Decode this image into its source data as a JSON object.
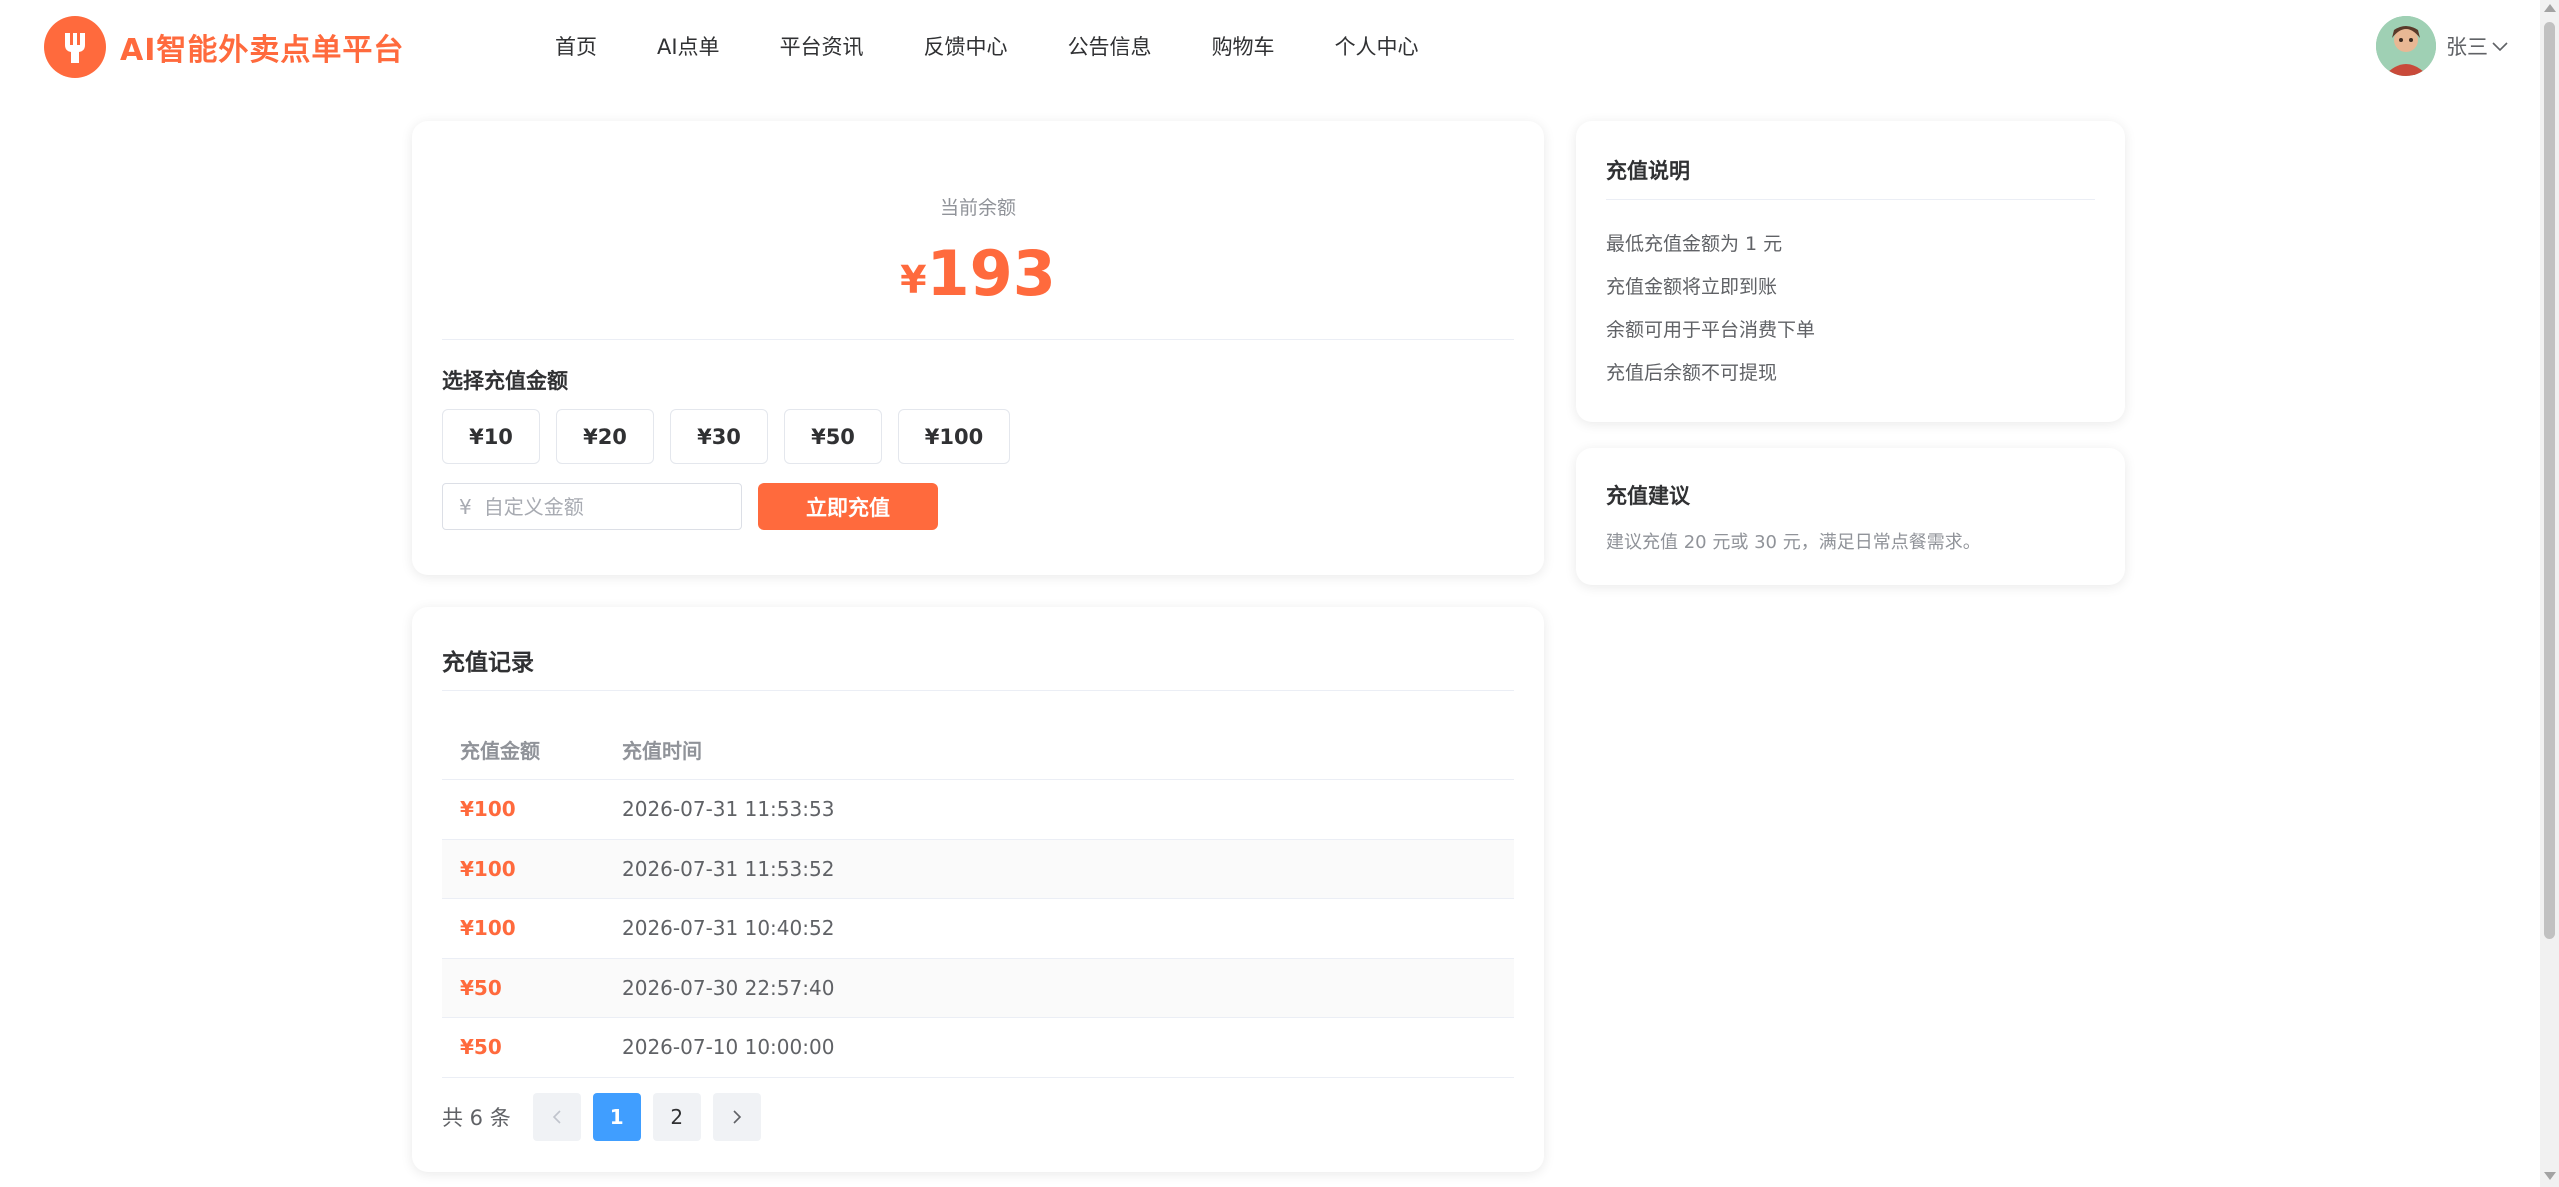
{
  "brand": {
    "name": "AI智能外卖点单平台",
    "color": "#ff6a3d",
    "logo_icon": "fork-knife-icon"
  },
  "nav": {
    "items": [
      {
        "label": "首页"
      },
      {
        "label": "AI点单"
      },
      {
        "label": "平台资讯"
      },
      {
        "label": "反馈中心"
      },
      {
        "label": "公告信息"
      },
      {
        "label": "购物车"
      },
      {
        "label": "个人中心"
      }
    ]
  },
  "user": {
    "name": "张三",
    "avatar_icon": "user-avatar",
    "dropdown_icon": "chevron-down-icon"
  },
  "balance": {
    "label": "当前余额",
    "currency": "¥",
    "amount": "193"
  },
  "recharge": {
    "title": "选择充值金额",
    "amounts": [
      "¥10",
      "¥20",
      "¥30",
      "¥50",
      "¥100"
    ],
    "custom_prefix": "¥",
    "custom_placeholder": "自定义金额",
    "custom_value": "",
    "submit_label": "立即充值"
  },
  "records": {
    "title": "充值记录",
    "columns": [
      "充值金额",
      "充值时间"
    ],
    "rows": [
      {
        "amount": "¥100",
        "time": "2026-07-31 11:53:53"
      },
      {
        "amount": "¥100",
        "time": "2026-07-31 11:53:52"
      },
      {
        "amount": "¥100",
        "time": "2026-07-31 10:40:52"
      },
      {
        "amount": "¥50",
        "time": "2026-07-30 22:57:40"
      },
      {
        "amount": "¥50",
        "time": "2026-07-10 10:00:00"
      }
    ],
    "pagination": {
      "total_text": "共 6 条",
      "pages": [
        "1",
        "2"
      ],
      "current": "1",
      "prev_icon": "chevron-left-icon",
      "next_icon": "chevron-right-icon"
    }
  },
  "explain": {
    "title": "充值说明",
    "items": [
      "最低充值金额为 1 元",
      "充值金额将立即到账",
      "余额可用于平台消费下单",
      "充值后余额不可提现"
    ]
  },
  "suggest": {
    "title": "充值建议",
    "text": "建议充值 20 元或 30 元，满足日常点餐需求。"
  },
  "colors": {
    "accent": "#ff6a3d",
    "pagination_active": "#409eff"
  }
}
